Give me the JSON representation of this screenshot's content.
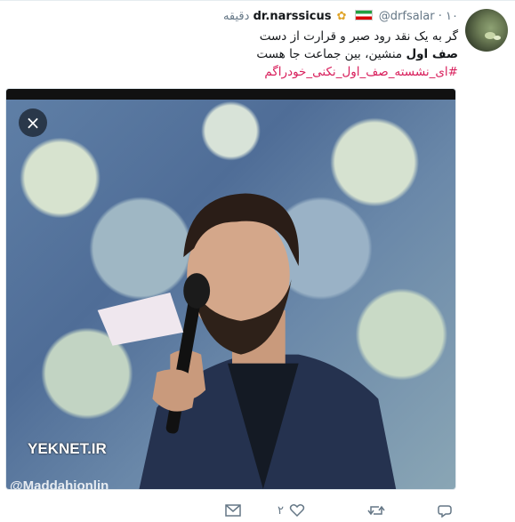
{
  "tweet": {
    "display_name": "dr.narssicus",
    "handle": "@drfsalar",
    "separator": "·",
    "time": "۱۰ دقیقه",
    "lines": [
      "گر به یک نقد رود صبر و قرارت از دست",
      {
        "bold": "صف اول",
        "rest": " منشین، بین جماعت جا هست"
      },
      "#ای_نشسته_صف_اول_نکنی_خودراگم"
    ],
    "hashtag": "#ای_نشسته_صف_اول_نکنی_خودراگم"
  },
  "media": {
    "watermark": "YEKNET.IR",
    "watermark2": "@Maddahionlin",
    "close_label": "×"
  },
  "actions": {
    "reply_icon": "reply-icon",
    "retweet_icon": "retweet-icon",
    "like_icon": "heart-icon",
    "like_count": "۲",
    "dm_icon": "mail-icon"
  },
  "colors": {
    "hashtag": "#d81e5b",
    "secondary_text": "#657786"
  }
}
